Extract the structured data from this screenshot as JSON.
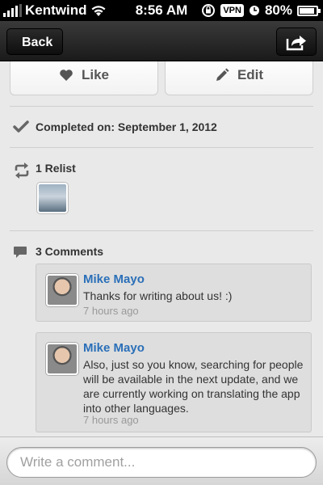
{
  "status_bar": {
    "carrier": "Kentwind",
    "time": "8:56 AM",
    "vpn_label": "VPN",
    "battery_percent": "80%",
    "battery_level": 0.8
  },
  "nav": {
    "back_label": "Back",
    "share_icon": "share-icon"
  },
  "actions": {
    "like_label": "Like",
    "edit_label": "Edit"
  },
  "completed": {
    "label": "Completed on: September 1, 2012"
  },
  "relist": {
    "label": "1 Relist"
  },
  "comments": {
    "header": "3 Comments",
    "items": [
      {
        "author": "Mike Mayo",
        "text": "Thanks for writing about us! :)",
        "time": "7 hours ago"
      },
      {
        "author": "Mike Mayo",
        "text": "Also, just so you know, searching for people will be available in the next update, and we are currently working on translating the app into other languages.",
        "time": "7 hours ago"
      }
    ]
  },
  "compose": {
    "placeholder": "Write a comment..."
  },
  "colors": {
    "link_blue": "#2a6fb8",
    "nav_dark": "#1a1a1a",
    "background": "#e9e9e9"
  }
}
